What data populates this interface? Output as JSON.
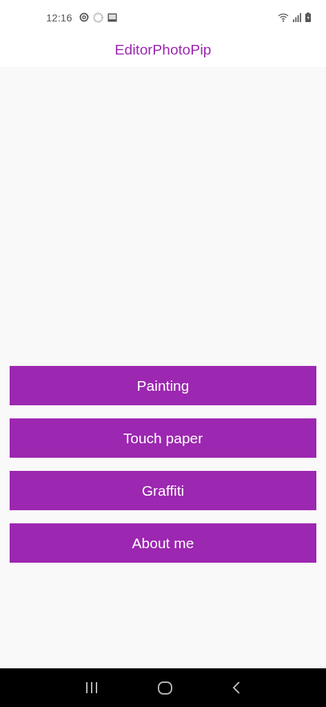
{
  "status_bar": {
    "time": "12:16"
  },
  "app_bar": {
    "title": "EditorPhotoPip"
  },
  "buttons": [
    {
      "label": "Painting"
    },
    {
      "label": "Touch paper"
    },
    {
      "label": "Graffiti"
    },
    {
      "label": "About me"
    }
  ]
}
